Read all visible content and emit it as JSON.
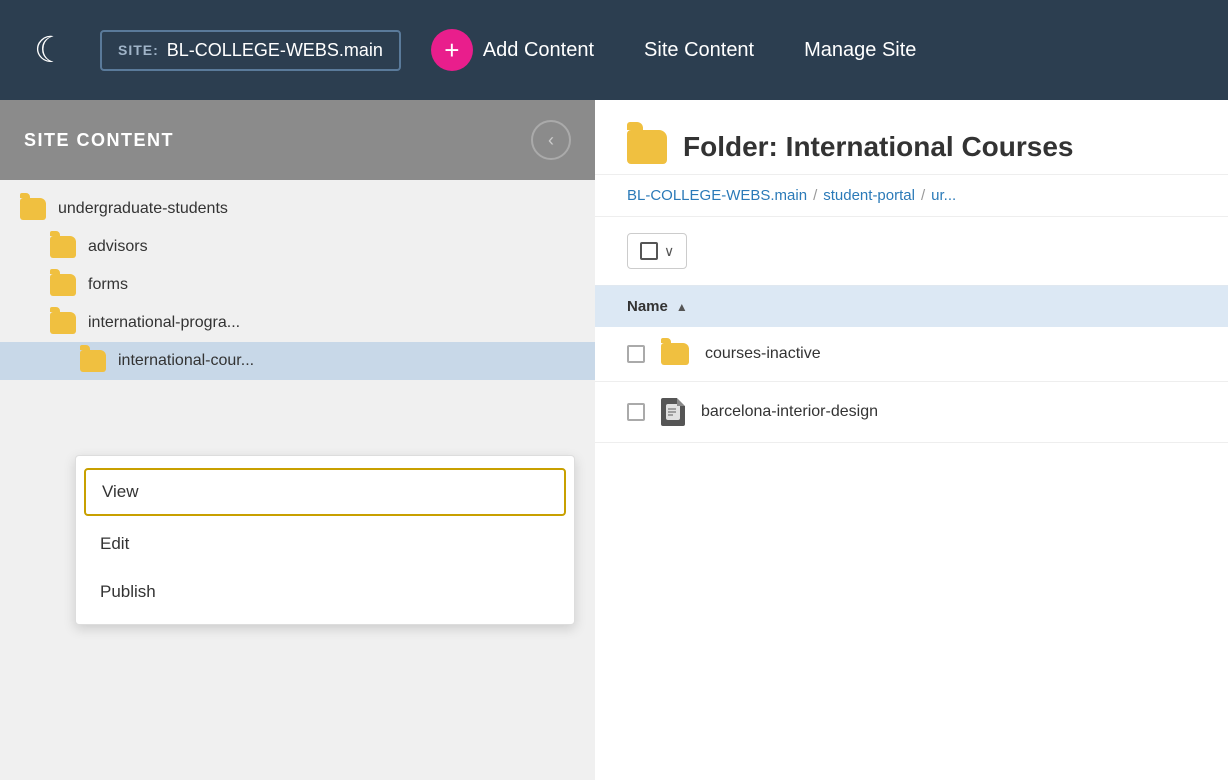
{
  "topNav": {
    "siteLabel": "SITE:",
    "siteName": "BL-COLLEGE-WEBS.main",
    "addContentLabel": "Add Content",
    "navItems": [
      "Site Content",
      "Manage Site"
    ]
  },
  "sidebar": {
    "title": "SITE CONTENT",
    "collapseIcon": "‹",
    "treeItems": [
      {
        "name": "undergraduate-students",
        "level": 0,
        "active": false
      },
      {
        "name": "advisors",
        "level": 1,
        "active": false
      },
      {
        "name": "forms",
        "level": 1,
        "active": false
      },
      {
        "name": "international-progra...",
        "level": 1,
        "active": false
      },
      {
        "name": "international-cour...",
        "level": 2,
        "active": true
      }
    ]
  },
  "contextMenu": {
    "items": [
      {
        "label": "View",
        "highlighted": true
      },
      {
        "label": "Edit",
        "highlighted": false
      },
      {
        "label": "Publish",
        "highlighted": false
      }
    ]
  },
  "rightPanel": {
    "folderTitle": "Folder: International Courses",
    "breadcrumb": {
      "parts": [
        "BL-COLLEGE-WEBS.main",
        "student-portal",
        "ur..."
      ]
    },
    "tableHeader": {
      "nameLabel": "Name",
      "sortArrow": "▲"
    },
    "rows": [
      {
        "type": "folder",
        "name": "courses-inactive"
      },
      {
        "type": "file",
        "name": "barcelona-interior-design"
      }
    ]
  }
}
